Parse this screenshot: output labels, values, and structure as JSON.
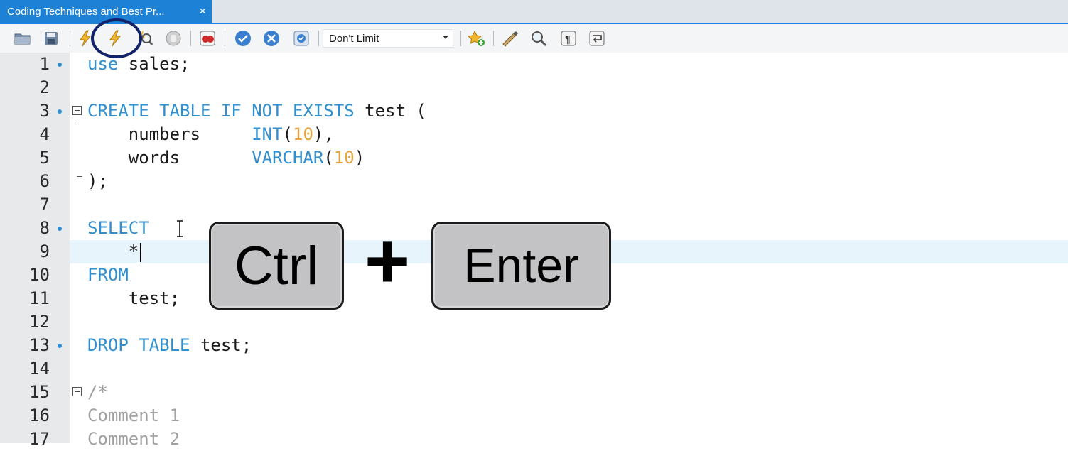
{
  "tab": {
    "title": "Coding Techniques and Best Pr...",
    "close": "×"
  },
  "toolbar": {
    "limit_value": "Don't Limit",
    "icons": [
      "open-folder-icon",
      "save-icon",
      "execute-icon",
      "execute-statement-icon",
      "explain-icon",
      "stop-icon",
      "stop-on-error-icon",
      "commit-icon",
      "rollback-icon",
      "autocommit-icon",
      "add-snippet-icon",
      "beautify-icon",
      "find-icon",
      "invisible-chars-icon",
      "word-wrap-icon"
    ]
  },
  "editor": {
    "lines": [
      {
        "n": "1",
        "dot": true,
        "text": "use sales;"
      },
      {
        "n": "2",
        "dot": false,
        "text": ""
      },
      {
        "n": "3",
        "dot": true,
        "text": "CREATE TABLE IF NOT EXISTS test ("
      },
      {
        "n": "4",
        "dot": false,
        "text": "    numbers     INT(10),"
      },
      {
        "n": "5",
        "dot": false,
        "text": "    words       VARCHAR(10)"
      },
      {
        "n": "6",
        "dot": false,
        "text": ");"
      },
      {
        "n": "7",
        "dot": false,
        "text": ""
      },
      {
        "n": "8",
        "dot": true,
        "text": "SELECT"
      },
      {
        "n": "9",
        "dot": false,
        "text": "    *"
      },
      {
        "n": "10",
        "dot": false,
        "text": "FROM"
      },
      {
        "n": "11",
        "dot": false,
        "text": "    test;"
      },
      {
        "n": "12",
        "dot": false,
        "text": ""
      },
      {
        "n": "13",
        "dot": true,
        "text": "DROP TABLE test;"
      },
      {
        "n": "14",
        "dot": false,
        "text": ""
      },
      {
        "n": "15",
        "dot": false,
        "text": "/*"
      },
      {
        "n": "16",
        "dot": false,
        "text": "Comment 1"
      },
      {
        "n": "17",
        "dot": false,
        "text": "Comment 2"
      }
    ]
  },
  "overlay": {
    "key1": "Ctrl",
    "plus": "+",
    "key2": "Enter"
  },
  "colors": {
    "accent": "#1d82d6",
    "keyword": "#2f8fcf",
    "number": "#e8a33d",
    "comment": "#a0a0a0",
    "circle": "#13236a"
  }
}
